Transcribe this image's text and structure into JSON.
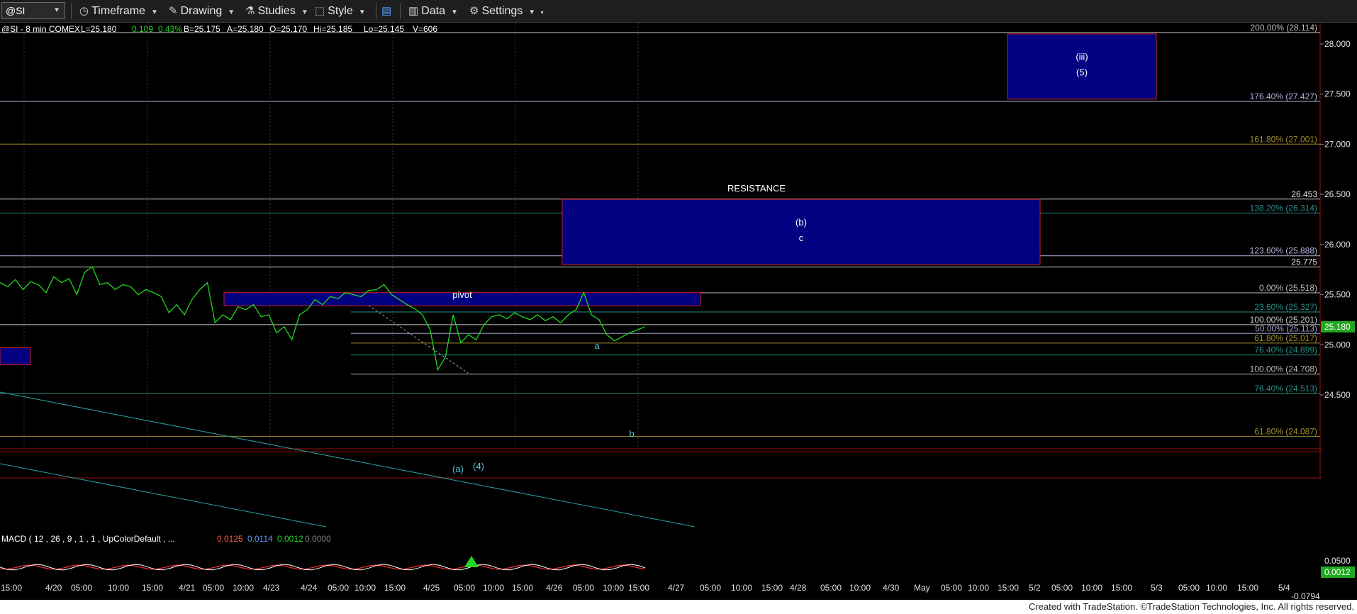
{
  "toolbar": {
    "symbol": "@SI",
    "items": [
      {
        "label": "Timeframe",
        "icon": "clock-icon"
      },
      {
        "label": "Drawing",
        "icon": "pencil-icon"
      },
      {
        "label": "Studies",
        "icon": "flask-icon"
      },
      {
        "label": "Style",
        "icon": "style-icon"
      },
      {
        "label": "",
        "icon": "panels-icon"
      },
      {
        "label": "Data",
        "icon": "bar-chart-icon"
      },
      {
        "label": "Settings",
        "icon": "gear-icon"
      }
    ]
  },
  "header": {
    "symbol_info": "@SI - 8 min  COMEX",
    "last": "L=25.180",
    "change": "0.109",
    "change_pct": "0.43%",
    "bid": "B=25.175",
    "ask": "A=25.180",
    "open": "O=25.170",
    "high": "Hi=25.185",
    "low": "Lo=25.145",
    "volume": "V=606"
  },
  "colors": {
    "price": "#22d822",
    "box_fill": "#000080",
    "box_border": "#cc2222",
    "annotation": "#4fc3d8",
    "last_price_tag": "#1fa81f",
    "macd_line": "#ffffff",
    "macd_signal": "#ff3030",
    "macd_hist": "#22d822",
    "trendline": "#2aa0a8"
  },
  "chart_data": {
    "type": "line",
    "title": "@SI - 8 min COMEX",
    "price_axis": {
      "min": 24.0,
      "max": 28.1,
      "ticks": [
        "28.000",
        "27.500",
        "27.000",
        "26.500",
        "26.000",
        "25.500",
        "25.000",
        "24.500"
      ]
    },
    "time_axis_labels": [
      "15:00",
      "4/20",
      "05:00",
      "10:00",
      "15:00",
      "4/21",
      "05:00",
      "10:00",
      "4/23",
      "4/24",
      "05:00",
      "10:00",
      "15:00",
      "4/25",
      "05:00",
      "10:00",
      "15:00",
      "4/26",
      "05:00",
      "10:00",
      "15:00",
      "4/27",
      "05:00",
      "10:00",
      "15:00",
      "4/28",
      "05:00",
      "10:00",
      "4/30",
      "May",
      "05:00",
      "10:00",
      "15:00",
      "5/2",
      "05:00",
      "10:00",
      "15:00",
      "5/3",
      "05:00",
      "10:00",
      "15:00",
      "5/4"
    ],
    "series": [
      {
        "values": [
          25.62,
          25.58,
          25.65,
          25.55,
          25.63,
          25.6,
          25.52,
          25.68,
          25.62,
          25.66,
          25.5,
          25.72,
          25.78,
          25.6,
          25.62,
          25.55,
          25.6,
          25.58,
          25.5,
          25.55,
          25.52,
          25.48,
          25.32,
          25.4,
          25.3,
          25.45,
          25.55,
          25.62,
          25.22,
          25.3,
          25.25,
          25.38,
          25.35,
          25.4,
          25.28,
          25.3,
          25.12,
          25.18,
          25.05,
          25.3,
          25.35,
          25.45,
          25.4,
          25.48,
          25.46,
          25.52,
          25.5,
          25.48,
          25.54,
          25.55,
          25.6,
          25.5,
          25.45,
          25.4,
          25.36,
          25.3,
          25.15,
          24.75,
          24.88,
          25.3,
          25.02,
          25.1,
          25.05,
          25.2,
          25.28,
          25.3,
          25.26,
          25.32,
          25.28,
          25.25,
          25.3,
          25.24,
          25.28,
          25.22,
          25.3,
          25.35,
          25.52,
          25.3,
          25.25,
          25.1,
          25.04,
          25.08,
          25.12,
          25.15,
          25.18
        ]
      }
    ],
    "fib_levels": [
      {
        "label": "200.00% (28.114)",
        "value": 28.114,
        "color": "#bbbbbb"
      },
      {
        "label": "176.40% (27.427)",
        "value": 27.427,
        "color": "#b0b0d8"
      },
      {
        "label": "161.80% (27.001)",
        "value": 27.001,
        "color": "#a08c28"
      },
      {
        "label": "138.20% (26.314)",
        "value": 26.314,
        "color": "#2a9088"
      },
      {
        "label": "123.60% (25.888)",
        "value": 25.888,
        "color": "#b0b0d8"
      },
      {
        "label": "0.00% (25.518)",
        "value": 25.518,
        "color": "#bbbbbb"
      },
      {
        "label": "23.60% (25.327)",
        "value": 25.327,
        "color": "#2a9088"
      },
      {
        "label": "100.00% (25.201)",
        "value": 25.201,
        "color": "#c8c8c8"
      },
      {
        "label": "50.00% (25.113)",
        "value": 25.113,
        "color": "#a0a0c8"
      },
      {
        "label": "61.80% (25.017)",
        "value": 25.017,
        "color": "#a08c28"
      },
      {
        "label": "76.40% (24.899)",
        "value": 24.899,
        "color": "#2a9088"
      },
      {
        "label": "100.00% (24.708)",
        "value": 24.708,
        "color": "#bbbbbb"
      },
      {
        "label": "76.40% (24.513)",
        "value": 24.513,
        "color": "#2a9088"
      },
      {
        "label": "61.80% (24.087)",
        "value": 24.087,
        "color": "#a08c28"
      }
    ],
    "price_tags": [
      {
        "label": "26.453",
        "value": 26.453
      },
      {
        "label": "25.775",
        "value": 25.775
      }
    ],
    "last_price": {
      "label": "25.180",
      "value": 25.18
    },
    "boxes": [
      {
        "name": "iii-target-box",
        "top": 28.1,
        "bottom": 27.45,
        "labels": [
          "(iii)",
          "(5)"
        ]
      },
      {
        "name": "resistance-box",
        "top": 26.45,
        "bottom": 25.8,
        "labels": [
          "(b)",
          "c"
        ],
        "title": "RESISTANCE"
      },
      {
        "name": "pivot-box",
        "top": 25.52,
        "bottom": 25.39,
        "labels": [
          "pivot"
        ]
      },
      {
        "name": "left-box",
        "top": 24.97,
        "bottom": 24.8,
        "labels": []
      }
    ],
    "wave_labels": [
      "a",
      "b",
      "(a)",
      "(4)"
    ],
    "macd": {
      "legend": "MACD ( 12 , 26 , 9 , 1 , 1 , UpColorDefault , ...",
      "v1": "0.0125",
      "v2": "0.0114",
      "v3": "0.0012",
      "v4": "0.0000",
      "axis_labels": [
        "0.0500",
        "-0.0794"
      ],
      "tag": "0.0012"
    }
  },
  "footer": {
    "text": "Created with TradeStation. ©TradeStation Technologies, Inc. All rights reserved."
  }
}
